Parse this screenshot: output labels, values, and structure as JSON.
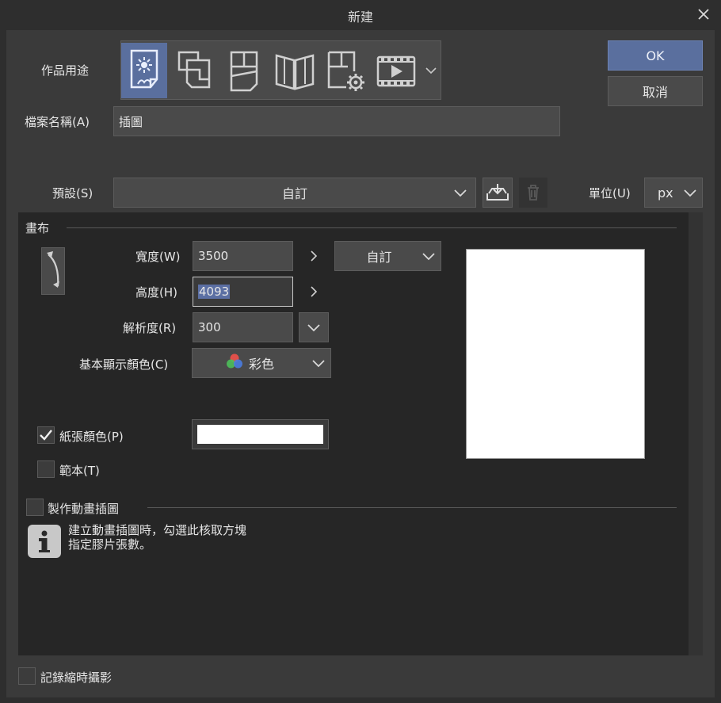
{
  "window": {
    "title": "新建"
  },
  "usage": {
    "label": "作品用途",
    "icons": [
      "illustration-icon",
      "comic-icon",
      "single-page-comic-icon",
      "book-icon",
      "page-settings-icon",
      "animation-icon"
    ]
  },
  "filename": {
    "label": "檔案名稱(A)",
    "value": "插圖"
  },
  "buttons": {
    "ok": "OK",
    "cancel": "取消"
  },
  "preset": {
    "label": "預設(S)",
    "value": "自訂"
  },
  "unit": {
    "label": "單位(U)",
    "value": "px"
  },
  "canvas": {
    "section_title": "畫布",
    "width": {
      "label": "寬度(W)",
      "value": "3500"
    },
    "height": {
      "label": "高度(H)",
      "value": "4093"
    },
    "size_preset": "自訂",
    "resolution": {
      "label": "解析度(R)",
      "value": "300"
    },
    "color_mode": {
      "label": "基本顯示顏色(C)",
      "value": "彩色"
    },
    "paper_color": {
      "label": "紙張顏色(P)",
      "checked": true,
      "color": "#ffffff"
    },
    "template": {
      "label": "範本(T)",
      "checked": false
    }
  },
  "animation": {
    "label": "製作動畫插圖",
    "checked": false,
    "info": [
      "建立動畫插圖時，勾選此核取方塊",
      "指定膠片張數。"
    ]
  },
  "timelapse": {
    "label": "記錄縮時攝影",
    "checked": false
  },
  "colors": {
    "accent": "#5a6f9e",
    "background": "#3a3a3a",
    "panel": "#262626"
  }
}
